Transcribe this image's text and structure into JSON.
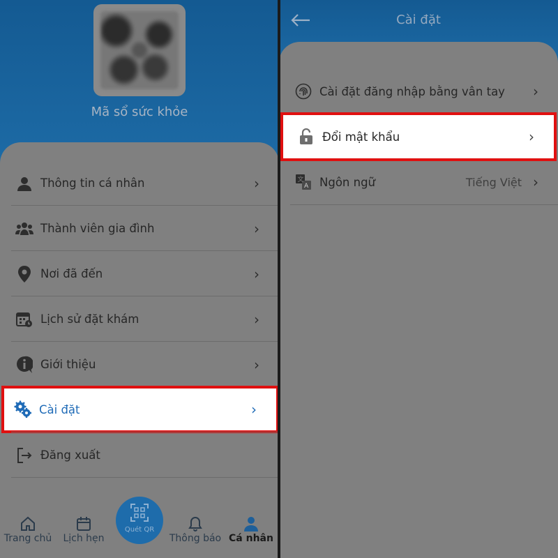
{
  "left": {
    "qr_caption": "Mã sổ sức khỏe",
    "menu": [
      {
        "label": "Thông tin cá nhân",
        "icon": "person-icon"
      },
      {
        "label": "Thành viên gia đình",
        "icon": "family-icon"
      },
      {
        "label": "Nơi đã đến",
        "icon": "location-pin-icon"
      },
      {
        "label": "Lịch sử đặt khám",
        "icon": "calendar-history-icon"
      },
      {
        "label": "Giới thiệu",
        "icon": "info-icon"
      },
      {
        "label": "Cài đặt",
        "icon": "gear-icon",
        "highlighted": true
      },
      {
        "label": "Đăng xuất",
        "icon": "logout-icon"
      }
    ],
    "bottom_nav": [
      {
        "label": "Trang chủ",
        "icon": "home-icon"
      },
      {
        "label": "Lịch hẹn",
        "icon": "calendar-icon"
      },
      {
        "label": "Quét QR",
        "icon": "qr-scan-icon"
      },
      {
        "label": "Thông báo",
        "icon": "bell-icon"
      },
      {
        "label": "Cá nhân",
        "icon": "user-icon",
        "active": true
      }
    ]
  },
  "right": {
    "title": "Cài đặt",
    "settings": [
      {
        "label": "Cài đặt đăng nhập bằng vân tay",
        "icon": "fingerprint-icon"
      },
      {
        "label": "Đổi mật khẩu",
        "icon": "lock-icon",
        "highlighted": true
      },
      {
        "label": "Ngôn ngữ",
        "icon": "language-icon",
        "value": "Tiếng Việt"
      }
    ]
  },
  "colors": {
    "highlight_border": "#e01010",
    "accent_blue": "#1f6bb7",
    "header_blue": "#1d6ba6"
  }
}
